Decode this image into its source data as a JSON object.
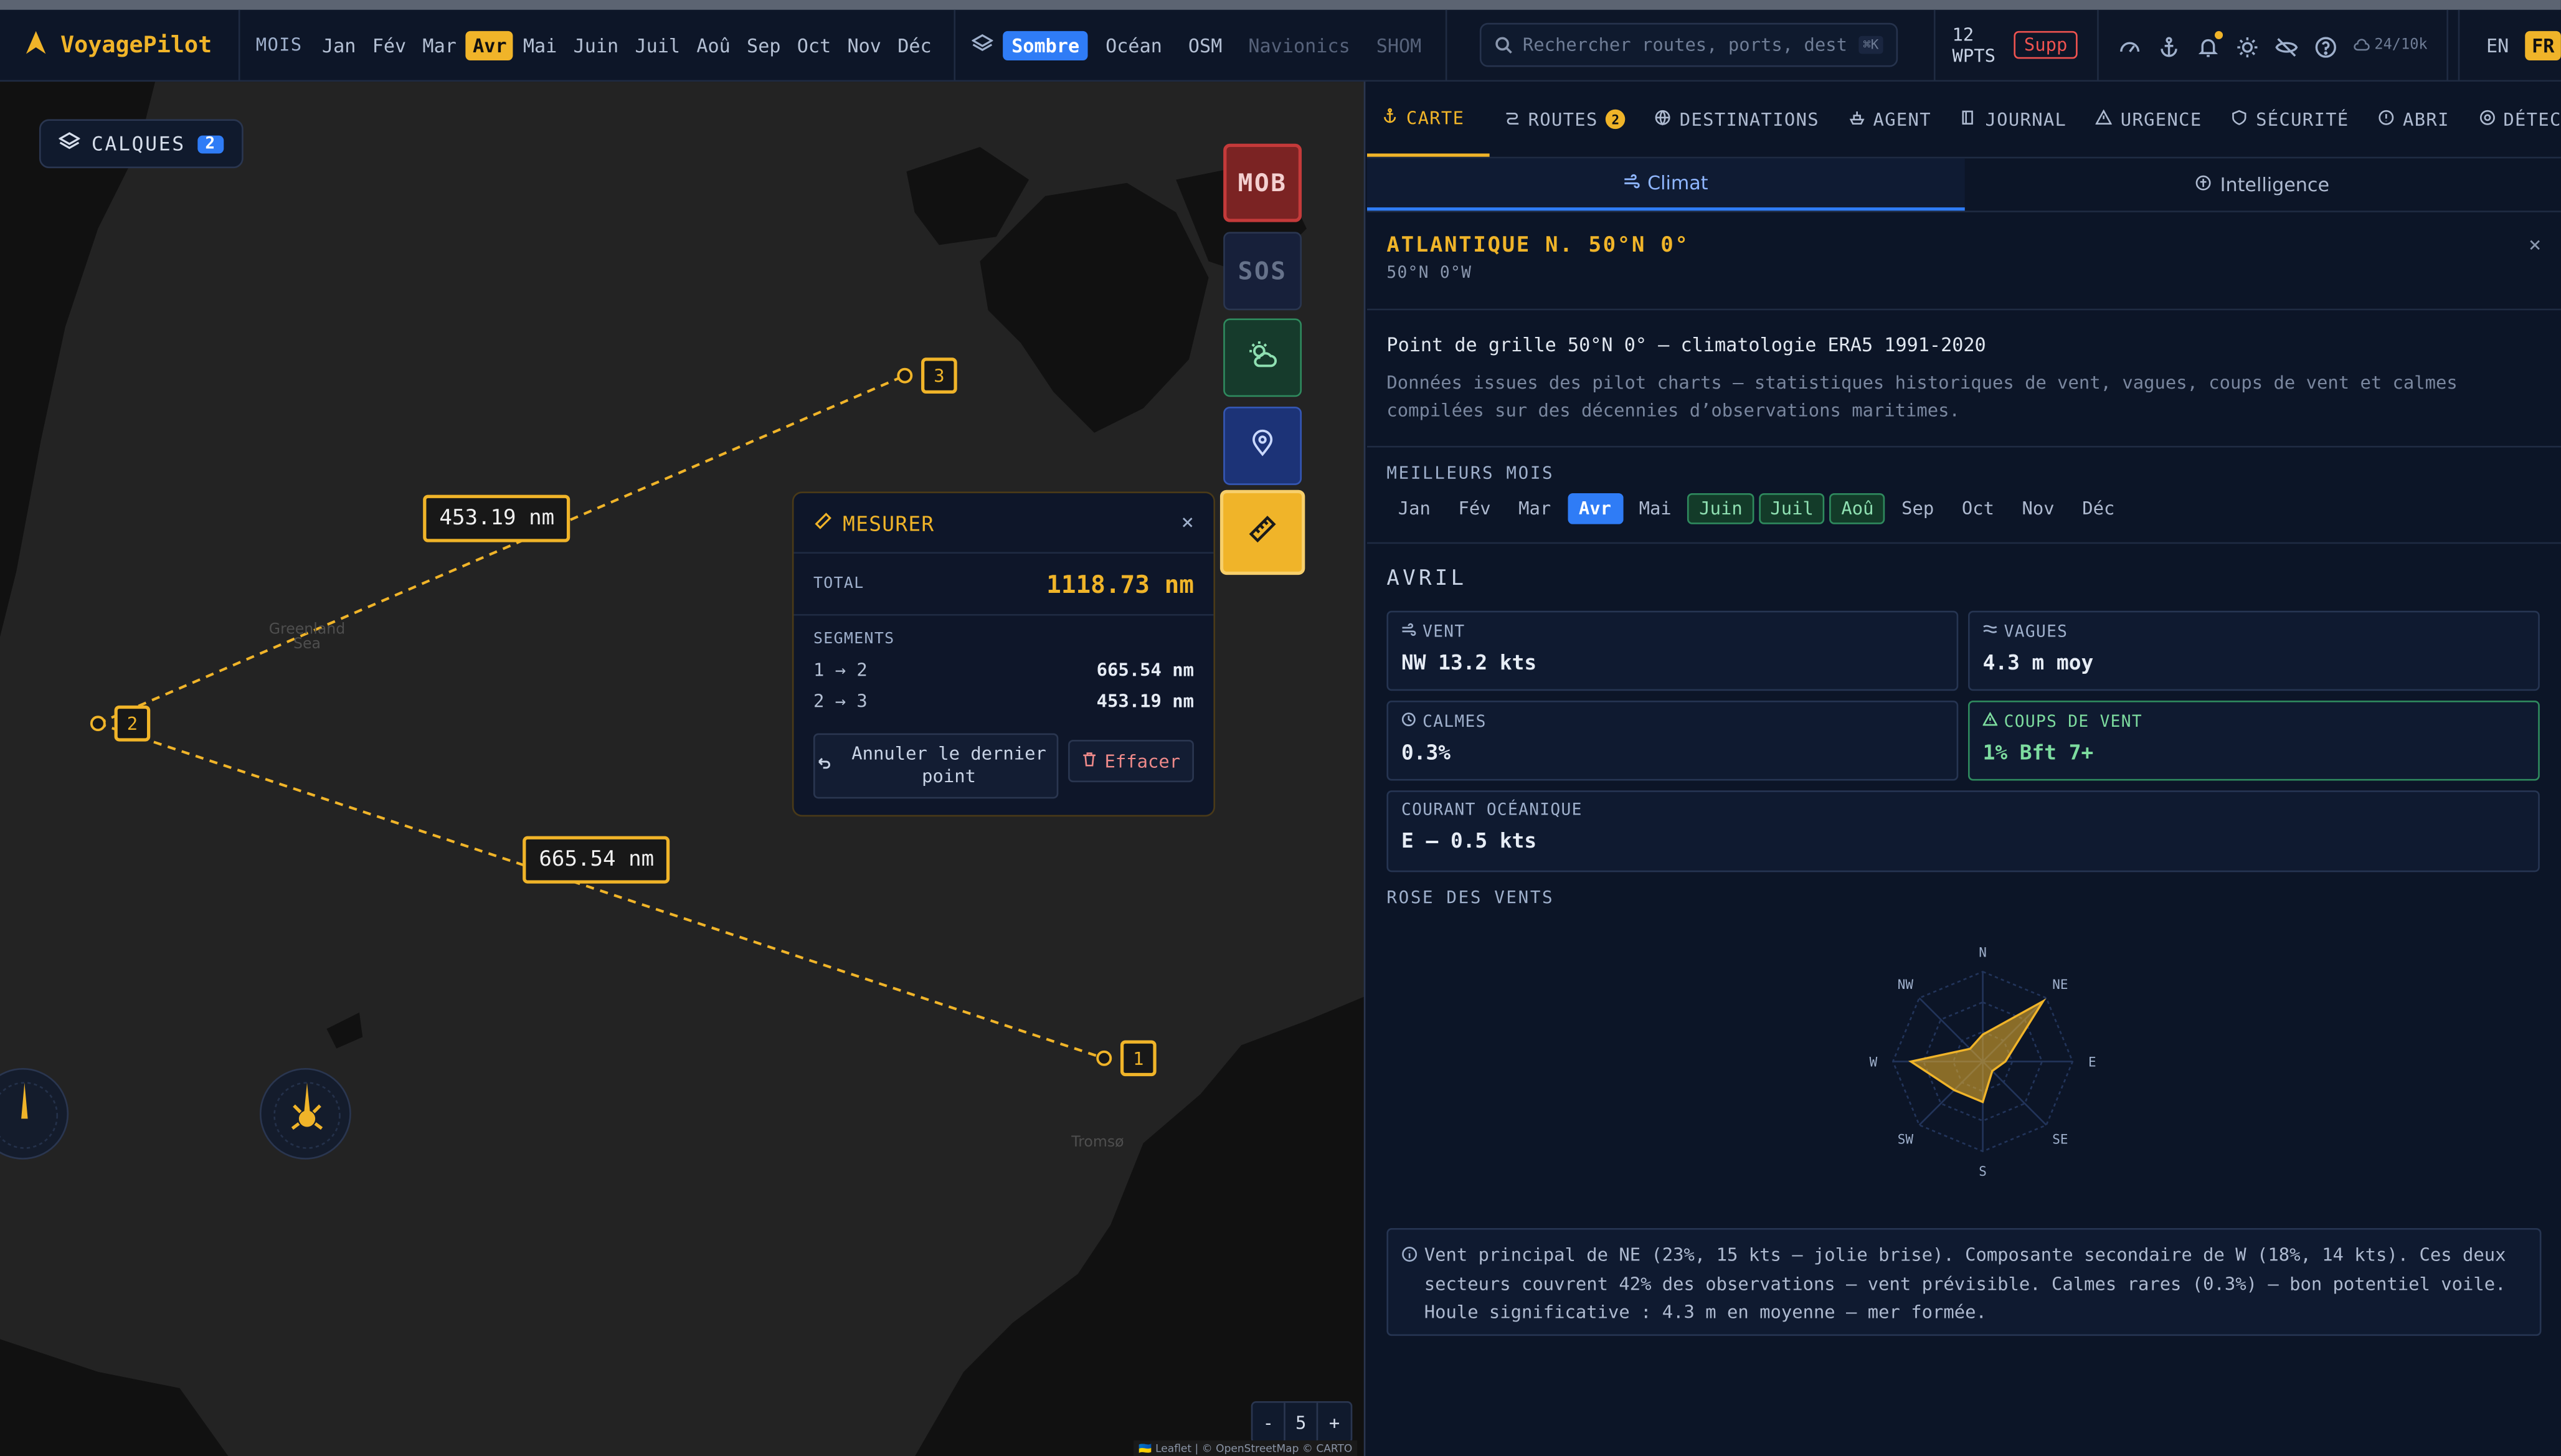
{
  "app": {
    "name": "VoyagePilot"
  },
  "months_bar": {
    "label": "MOIS",
    "items": [
      "Jan",
      "Fév",
      "Mar",
      "Avr",
      "Mai",
      "Juin",
      "Juil",
      "Aoû",
      "Sep",
      "Oct",
      "Nov",
      "Déc"
    ],
    "active": "Avr"
  },
  "basemaps": {
    "items": [
      {
        "label": "Sombre",
        "state": "active"
      },
      {
        "label": "Océan",
        "state": "normal"
      },
      {
        "label": "OSM",
        "state": "normal"
      },
      {
        "label": "Navionics",
        "state": "disabled"
      },
      {
        "label": "SHOM",
        "state": "disabled"
      }
    ]
  },
  "search": {
    "placeholder": "Rechercher routes, ports, destinations",
    "shortcut": "⌘K"
  },
  "waypoints": {
    "count_label": "12 WPTS",
    "delete_label": "Supp"
  },
  "quota": "24/10k",
  "languages": {
    "items": [
      "EN",
      "FR"
    ],
    "active": "FR"
  },
  "map": {
    "layers_label": "CALQUES",
    "layers_count": "2",
    "place_labels": [
      "Greenland Sea",
      "Tromsø"
    ],
    "segment_labels": [
      "453.19 nm",
      "665.54 nm"
    ],
    "waypoint_labels": [
      "1",
      "2",
      "3"
    ],
    "buttons": {
      "mob": "MOB",
      "sos": "SOS"
    },
    "zoom": {
      "minus": "-",
      "level": "5",
      "plus": "+"
    },
    "attribution": "🇺🇦 Leaflet | © OpenStreetMap © CARTO"
  },
  "measure": {
    "title": "MESURER",
    "close": "×",
    "total_label": "TOTAL",
    "total_value": "1118.73 nm",
    "segments_label": "SEGMENTS",
    "segments": [
      {
        "legs": "1 → 2",
        "distance": "665.54 nm"
      },
      {
        "legs": "2 → 3",
        "distance": "453.19 nm"
      }
    ],
    "undo_label": "Annuler le dernier point",
    "clear_label": "Effacer"
  },
  "panel": {
    "tabs": [
      {
        "label": "CARTE",
        "active": true,
        "icon": "anchor-icon"
      },
      {
        "label": "ROUTES",
        "badge": "2",
        "icon": "route-icon"
      },
      {
        "label": "DESTINATIONS",
        "icon": "globe-icon"
      },
      {
        "label": "AGENT",
        "icon": "ship-icon"
      },
      {
        "label": "JOURNAL",
        "icon": "book-icon"
      },
      {
        "label": "URGENCE",
        "icon": "warning-icon"
      },
      {
        "label": "SÉCURITÉ",
        "icon": "shield-icon"
      },
      {
        "label": "ABRI",
        "icon": "alert-icon"
      },
      {
        "label": "DÉTECTION",
        "icon": "radar-icon"
      }
    ],
    "subtabs": [
      {
        "label": "Climat",
        "active": true
      },
      {
        "label": "Intelligence",
        "active": false
      }
    ],
    "location": {
      "title": "ATLANTIQUE N. 50°N 0°",
      "coords": "50°N 0°W",
      "close": "×"
    },
    "description": {
      "title": "Point de grille 50°N 0° — climatologie ERA5 1991-2020",
      "text": "Données issues des pilot charts — statistiques historiques de vent, vagues, coups de vent et calmes compilées sur des décennies d’observations maritimes."
    },
    "best_months": {
      "label": "MEILLEURS MOIS",
      "items": [
        {
          "m": "Jan",
          "s": "n"
        },
        {
          "m": "Fév",
          "s": "n"
        },
        {
          "m": "Mar",
          "s": "n"
        },
        {
          "m": "Avr",
          "s": "cur"
        },
        {
          "m": "Mai",
          "s": "n"
        },
        {
          "m": "Juin",
          "s": "good"
        },
        {
          "m": "Juil",
          "s": "good"
        },
        {
          "m": "Aoû",
          "s": "good"
        },
        {
          "m": "Sep",
          "s": "n"
        },
        {
          "m": "Oct",
          "s": "n"
        },
        {
          "m": "Nov",
          "s": "n"
        },
        {
          "m": "Déc",
          "s": "n"
        }
      ]
    },
    "month_title": "AVRIL",
    "stats": {
      "wind": {
        "label": "VENT",
        "value": "NW 13.2 kts"
      },
      "waves": {
        "label": "VAGUES",
        "value": "4.3 m moy"
      },
      "calms": {
        "label": "CALMES",
        "value": "0.3%"
      },
      "gales": {
        "label": "COUPS DE VENT",
        "value": "1% Bft 7+"
      },
      "current": {
        "label": "COURANT OCÉANIQUE",
        "value": "E — 0.5 kts"
      }
    },
    "wind_rose": {
      "label": "ROSE DES VENTS",
      "directions": [
        "N",
        "NE",
        "E",
        "SE",
        "S",
        "SW",
        "W",
        "NW"
      ],
      "values": [
        0.3,
        0.95,
        0.25,
        0.15,
        0.45,
        0.45,
        0.8,
        0.2
      ]
    },
    "summary": "Vent principal de NE (23%, 15 kts — jolie brise). Composante secondaire de W (18%, 14 kts). Ces deux secteurs couvrent 42% des observations — vent prévisible. Calmes rares (0.3%) — bon potentiel voile. Houle significative : 4.3 m en moyenne — mer formée."
  }
}
